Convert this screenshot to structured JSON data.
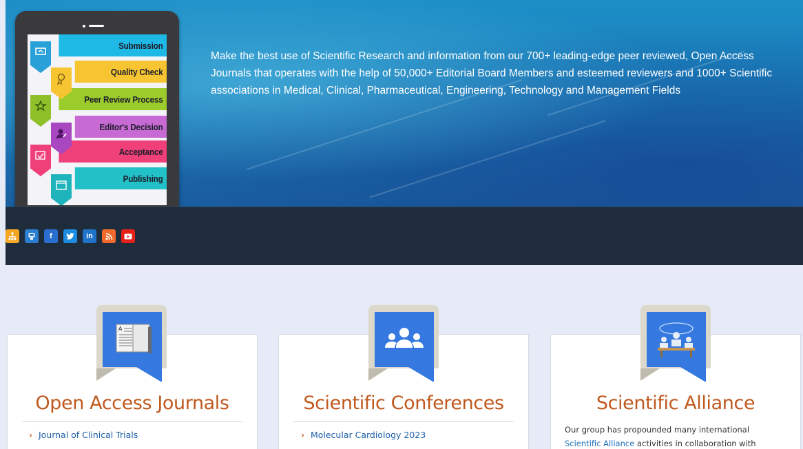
{
  "hero": {
    "text": "Make the best use of Scientific Research and information from our 700+ leading-edge peer reviewed, Open Access Journals that operates with the help of 50,000+ Editorial Board Members and esteemed reviewers and 1000+ Scientific associations in Medical, Clinical, Pharmaceutical, Engineering, Technology and Management Fields",
    "steps": [
      {
        "label": "Submission",
        "color": "#1fb9e6",
        "icon": "monitor-icon"
      },
      {
        "label": "Quality Check",
        "color": "#f6c531",
        "icon": "ribbon-icon"
      },
      {
        "label": "Peer Review Process",
        "color": "#9ccb2c",
        "icon": "star-icon"
      },
      {
        "label": "Editor's Decision",
        "color": "#c86ad4",
        "icon": "editor-icon"
      },
      {
        "label": "Acceptance",
        "color": "#f0407a",
        "icon": "check-icon"
      },
      {
        "label": "Publishing",
        "color": "#21c1c7",
        "icon": "browser-icon"
      }
    ]
  },
  "social": [
    {
      "name": "sitemap-icon",
      "glyph": "",
      "color": "#f5a623"
    },
    {
      "name": "reader-icon",
      "glyph": "",
      "color": "#2a7fd0"
    },
    {
      "name": "facebook-icon",
      "glyph": "f",
      "color": "#2a6fd0"
    },
    {
      "name": "twitter-icon",
      "glyph": "",
      "color": "#1d8ce0"
    },
    {
      "name": "linkedin-icon",
      "glyph": "in",
      "color": "#1f73c8"
    },
    {
      "name": "rss-icon",
      "glyph": "",
      "color": "#f26a2b"
    },
    {
      "name": "youtube-icon",
      "glyph": "",
      "color": "#e62117"
    }
  ],
  "cards": [
    {
      "title": "Open Access Journals",
      "icon": "open-book-icon",
      "items": [
        "Journal of Clinical Trials"
      ]
    },
    {
      "title": "Scientific Conferences",
      "icon": "group-icon",
      "items": [
        "Molecular Cardiology 2023"
      ]
    },
    {
      "title": "Scientific Alliance",
      "icon": "meeting-icon",
      "text_before": "Our group has propounded many international",
      "link": "Scientific Alliance",
      "text_after": "activities in collaboration with"
    }
  ]
}
